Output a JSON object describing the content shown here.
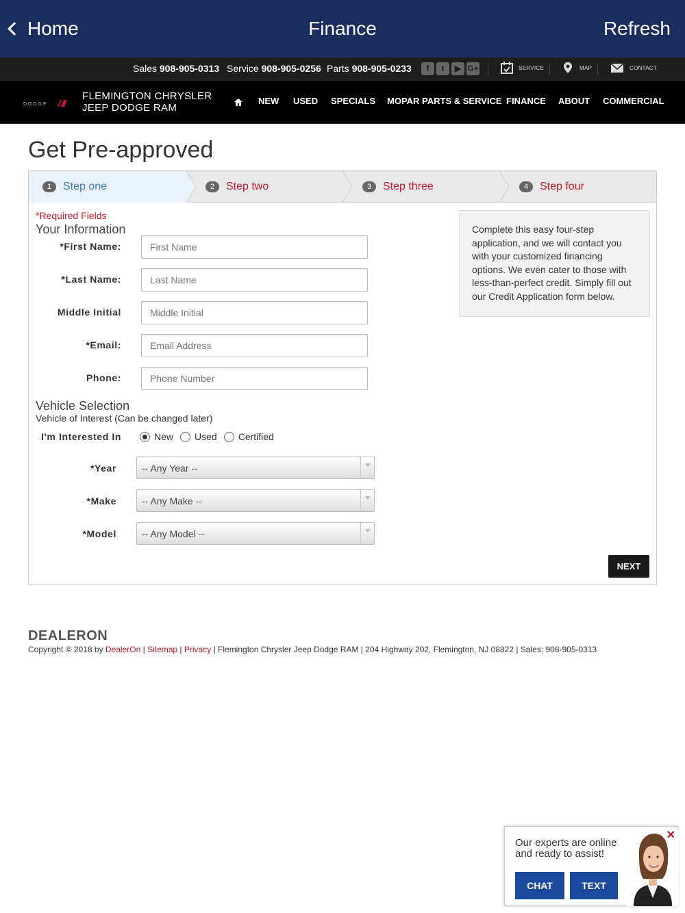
{
  "appbar": {
    "back_label": "Home",
    "title": "Finance",
    "refresh_label": "Refresh"
  },
  "strip": {
    "sales_label": "Sales",
    "sales_number": "908-905-0313",
    "service_label": "Service",
    "service_number": "908-905-0256",
    "parts_label": "Parts",
    "parts_number": "908-905-0233",
    "social": [
      "facebook-icon",
      "twitter-icon",
      "youtube-icon",
      "google-plus-icon"
    ],
    "links": {
      "service": "SERVICE",
      "map": "MAP",
      "contact": "CONTACT"
    }
  },
  "nav": {
    "dealer_line1": "FLEMINGTON CHRYSLER",
    "dealer_line2": "JEEP DODGE RAM",
    "items": [
      "NEW",
      "USED",
      "SPECIALS",
      "MOPAR PARTS & SERVICE",
      "FINANCE",
      "ABOUT",
      "COMMERCIAL"
    ]
  },
  "page": {
    "title": "Get Pre-approved"
  },
  "steps": [
    {
      "num": "1",
      "label": "Step one"
    },
    {
      "num": "2",
      "label": "Step two"
    },
    {
      "num": "3",
      "label": "Step three"
    },
    {
      "num": "4",
      "label": "Step four"
    }
  ],
  "form": {
    "required_note": "*Required Fields",
    "your_info": "Your Information",
    "fields": {
      "first_name": {
        "label": "*First Name:",
        "placeholder": "First Name"
      },
      "last_name": {
        "label": "*Last Name:",
        "placeholder": "Last Name"
      },
      "middle_initial": {
        "label": "Middle Initial",
        "placeholder": "Middle Initial"
      },
      "email": {
        "label": "*Email:",
        "placeholder": "Email Address"
      },
      "phone": {
        "label": "Phone:",
        "placeholder": "Phone Number"
      }
    },
    "vehicle_selection": "Vehicle Selection",
    "vehicle_sub": "Vehicle of Interest (Can be changed later)",
    "interested_label": "I'm Interested In",
    "interest_options": [
      "New",
      "Used",
      "Certified"
    ],
    "interest_selected": "New",
    "year_label": "*Year",
    "year_value": "-- Any Year --",
    "make_label": "*Make",
    "make_value": "-- Any Make --",
    "model_label": "*Model",
    "model_value": "-- Any Model --",
    "next_label": "NEXT"
  },
  "info_text": "Complete this easy four-step application, and we will contact you with your customized financing options. We even cater to those with less-than-perfect credit. Simply fill out our Credit Application form below.",
  "footer": {
    "brand": "DEALERON",
    "copyright_prefix": "Copyright © 2018 by ",
    "dealeron_link": "DealerOn",
    "sitemap_link": "Sitemap",
    "privacy_link": "Privacy",
    "address": " | Flemington Chrysler Jeep Dodge RAM | 204 Highway 202, Flemington, NJ 08822 | Sales: 908-905-0313"
  },
  "chat": {
    "message": "Our experts are online and ready to assist!",
    "chat_label": "CHAT",
    "text_label": "TEXT",
    "close_glyph": "✕"
  },
  "colors": {
    "appbar": "#1b2c5e",
    "accent_red": "#c0172b",
    "step_blue": "#3a7bbf",
    "chat_button": "#1b4a9c"
  }
}
